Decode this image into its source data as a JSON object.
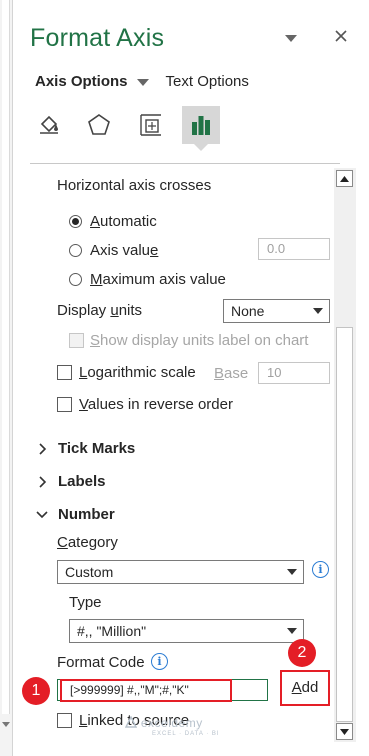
{
  "panel": {
    "title": "Format Axis",
    "dropdown_icon": "chevron-down-icon",
    "close_icon": "close-icon"
  },
  "tabs": [
    {
      "label": "Axis Options",
      "active": true
    },
    {
      "label": "Text Options",
      "active": false
    }
  ],
  "icon_tabs": [
    {
      "icon": "fill-line-icon",
      "active": false
    },
    {
      "icon": "effects-pentagon-icon",
      "active": false
    },
    {
      "icon": "size-properties-icon",
      "active": false
    },
    {
      "icon": "axis-options-bar-chart-icon",
      "active": true
    }
  ],
  "crosses": {
    "heading": "Horizontal axis crosses",
    "options": [
      {
        "label_pre": "",
        "mnemonic": "A",
        "label_post": "utomatic",
        "selected": true
      },
      {
        "label_pre": "Axis valu",
        "mnemonic": "e",
        "label_post": "",
        "selected": false
      },
      {
        "label_pre": "",
        "mnemonic": "M",
        "label_post": "aximum axis value",
        "selected": false
      }
    ],
    "axis_value": "0.0"
  },
  "display_units": {
    "label_pre": "Display ",
    "mnemonic": "u",
    "label_post": "nits",
    "value": "None",
    "show_label_pre": "",
    "show_label_mnemonic": "S",
    "show_label_post": "how display units label on chart"
  },
  "log_scale": {
    "label_pre": "",
    "mnemonic": "L",
    "label_post": "ogarithmic scale",
    "base_pre": "",
    "base_mnemonic": "B",
    "base_post": "ase",
    "base_value": "10"
  },
  "reverse": {
    "label_pre": "",
    "mnemonic": "V",
    "label_post": "alues in reverse order"
  },
  "sections": {
    "tick_marks": "Tick Marks",
    "labels": "Labels",
    "number": "Number"
  },
  "number": {
    "category_pre": "",
    "category_mnemonic": "C",
    "category_post": "ategory",
    "category_value": "Custom",
    "type_label": "Type",
    "type_value": "#,, \"Million\"",
    "format_code_label": "Format Code",
    "format_code_value": "[>999999] #,,\"M\";#,\"K\"",
    "add_pre": "",
    "add_mnemonic": "A",
    "add_post": "dd",
    "linked_pre": "",
    "linked_mnemonic": "L",
    "linked_post": "inked to source"
  },
  "callouts": [
    "1",
    "2"
  ],
  "watermark": {
    "name": "exceldemy",
    "tagline": "EXCEL · DATA · BI"
  },
  "colors": {
    "title_green": "#217346",
    "highlight_red": "#e41e26",
    "info_blue": "#2b7cd3"
  }
}
